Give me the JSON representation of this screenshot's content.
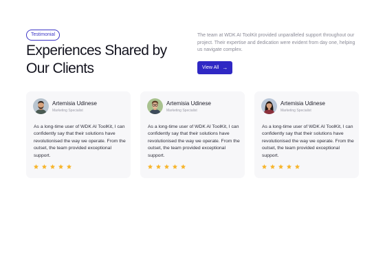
{
  "section": {
    "badge": "Testimonial",
    "title": "Experiences Shared by Our Clients",
    "intro": "The team at WDK AI ToolKit provided unparalleled support throughout our project. Their expertise and dedication were evident from day one, helping us navigate complex.",
    "view_all_label": "View All",
    "view_all_icon": "arrow-right-icon"
  },
  "colors": {
    "accent": "#2f28c4",
    "star": "#f7b52c",
    "card_bg": "#f7f7f9"
  },
  "testimonials": [
    {
      "name": "Artemisia Udinese",
      "role": "Marketing Specialist",
      "quote": "As a long-time user of WDK AI ToolKit, I can confidently say that their solutions have revolutionised the way we operate. From the outset, the team provided exceptional support.",
      "rating": 5,
      "avatar": "man-with-beard-avatar"
    },
    {
      "name": "Artemisia Udinese",
      "role": "Marketing Specialist",
      "quote": "As a long-time user of WDK AI ToolKit, I can confidently say that their solutions have revolutionised the way we operate. From the outset, the team provided exceptional support.",
      "rating": 5,
      "avatar": "man-with-glasses-avatar"
    },
    {
      "name": "Artemisia Udinese",
      "role": "Marketing Specialist",
      "quote": "As a long-time user of WDK AI ToolKit, I can confidently say that their solutions have revolutionised the way we operate. From the outset, the team provided exceptional support.",
      "rating": 5,
      "avatar": "woman-avatar"
    }
  ]
}
